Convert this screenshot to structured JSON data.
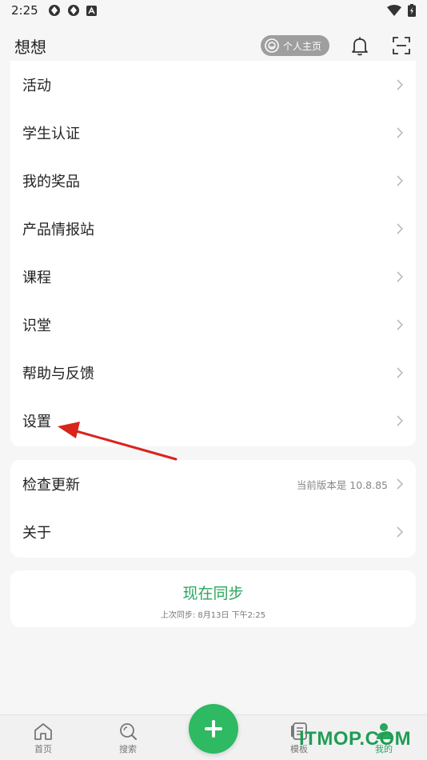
{
  "status_bar": {
    "time": "2:25"
  },
  "header": {
    "title": "想想",
    "profile_button": "个人主页"
  },
  "menu_items": [
    {
      "label": "活动"
    },
    {
      "label": "学生认证"
    },
    {
      "label": "我的奖品"
    },
    {
      "label": "产品情报站"
    },
    {
      "label": "课程"
    },
    {
      "label": "识堂"
    },
    {
      "label": "帮助与反馈"
    },
    {
      "label": "设置"
    }
  ],
  "about_section": {
    "check_update": {
      "label": "检查更新",
      "meta": "当前版本是 10.8.85"
    },
    "about": {
      "label": "关于"
    }
  },
  "sync": {
    "title": "现在同步",
    "subtitle": "上次同步: 8月13日 下午2:25"
  },
  "tab_bar": {
    "tabs": [
      {
        "label": "首页",
        "icon": "home-icon"
      },
      {
        "label": "搜索",
        "icon": "search-icon"
      },
      {
        "label": "模板",
        "icon": "template-icon"
      },
      {
        "label": "我的",
        "icon": "profile-icon"
      }
    ],
    "fab": "add-icon"
  },
  "watermark": "ITMOP.COM",
  "colors": {
    "accent": "#27a85b",
    "fab": "#2dba62",
    "arrow": "#d9241c",
    "pill": "#9e9e9e"
  }
}
